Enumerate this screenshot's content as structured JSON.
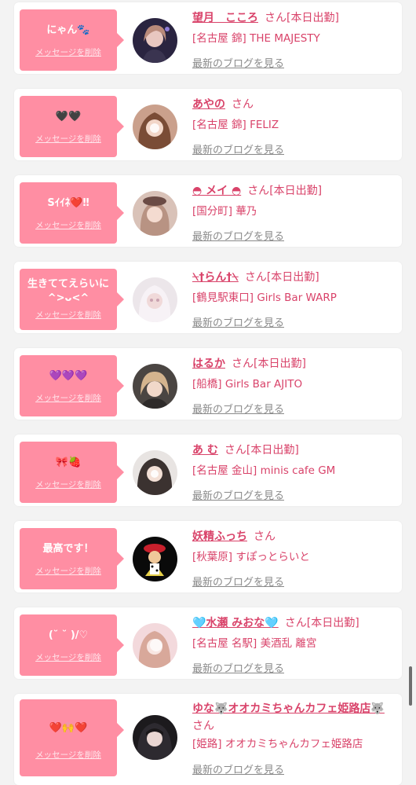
{
  "colors": {
    "accent": "#d9436a",
    "bubble": "#ff8ea3",
    "link_gray": "#8a8a8a"
  },
  "delete_label": "メッセージを削除",
  "blog_label": "最新のブログを見る",
  "san_label": "さん",
  "items": [
    {
      "message": "にゃん🐾",
      "name": "望月　こころ",
      "status": "[本日出勤]",
      "shop": "[名古屋 錦] THE MAJESTY"
    },
    {
      "message": "🖤🖤",
      "name": "あやの",
      "status": "",
      "shop": "[名古屋 錦] FELIZ"
    },
    {
      "message": "Sｲｲﾈ❤️‼︎",
      "name": "◓ メイ ◓",
      "status": "[本日出勤]",
      "shop": "[国分町] 華乃"
    },
    {
      "message": "生きててえらいに ^>ᴗ<^",
      "name": "⍀†らん†⍀",
      "status": "[本日出勤]",
      "shop": "[鶴見駅東口] Girls Bar WARP"
    },
    {
      "message": "💜💜💜",
      "name": "はるか",
      "status": "[本日出勤]",
      "shop": "[船橋] Girls Bar AJITO"
    },
    {
      "message": "🎀🍓",
      "name": "あ む",
      "status": "[本日出勤]",
      "shop": "[名古屋 金山] minis cafe GM"
    },
    {
      "message": "最高です！",
      "name": "妖精ふっち",
      "status": "",
      "shop": "[秋葉原] すぽっとらいと"
    },
    {
      "message": "(˘ ˘ )/♡",
      "name": "🩵水瀬 みおな🩵",
      "status": "[本日出勤]",
      "shop": "[名古屋 名駅] 美酒乱 離宮"
    },
    {
      "message": "❤️🙌❤️",
      "name": "ゆな🐺オオカミちゃんカフェ姫路店🐺",
      "status": "",
      "shop": "[姫路] オオカミちゃんカフェ姫路店"
    }
  ]
}
